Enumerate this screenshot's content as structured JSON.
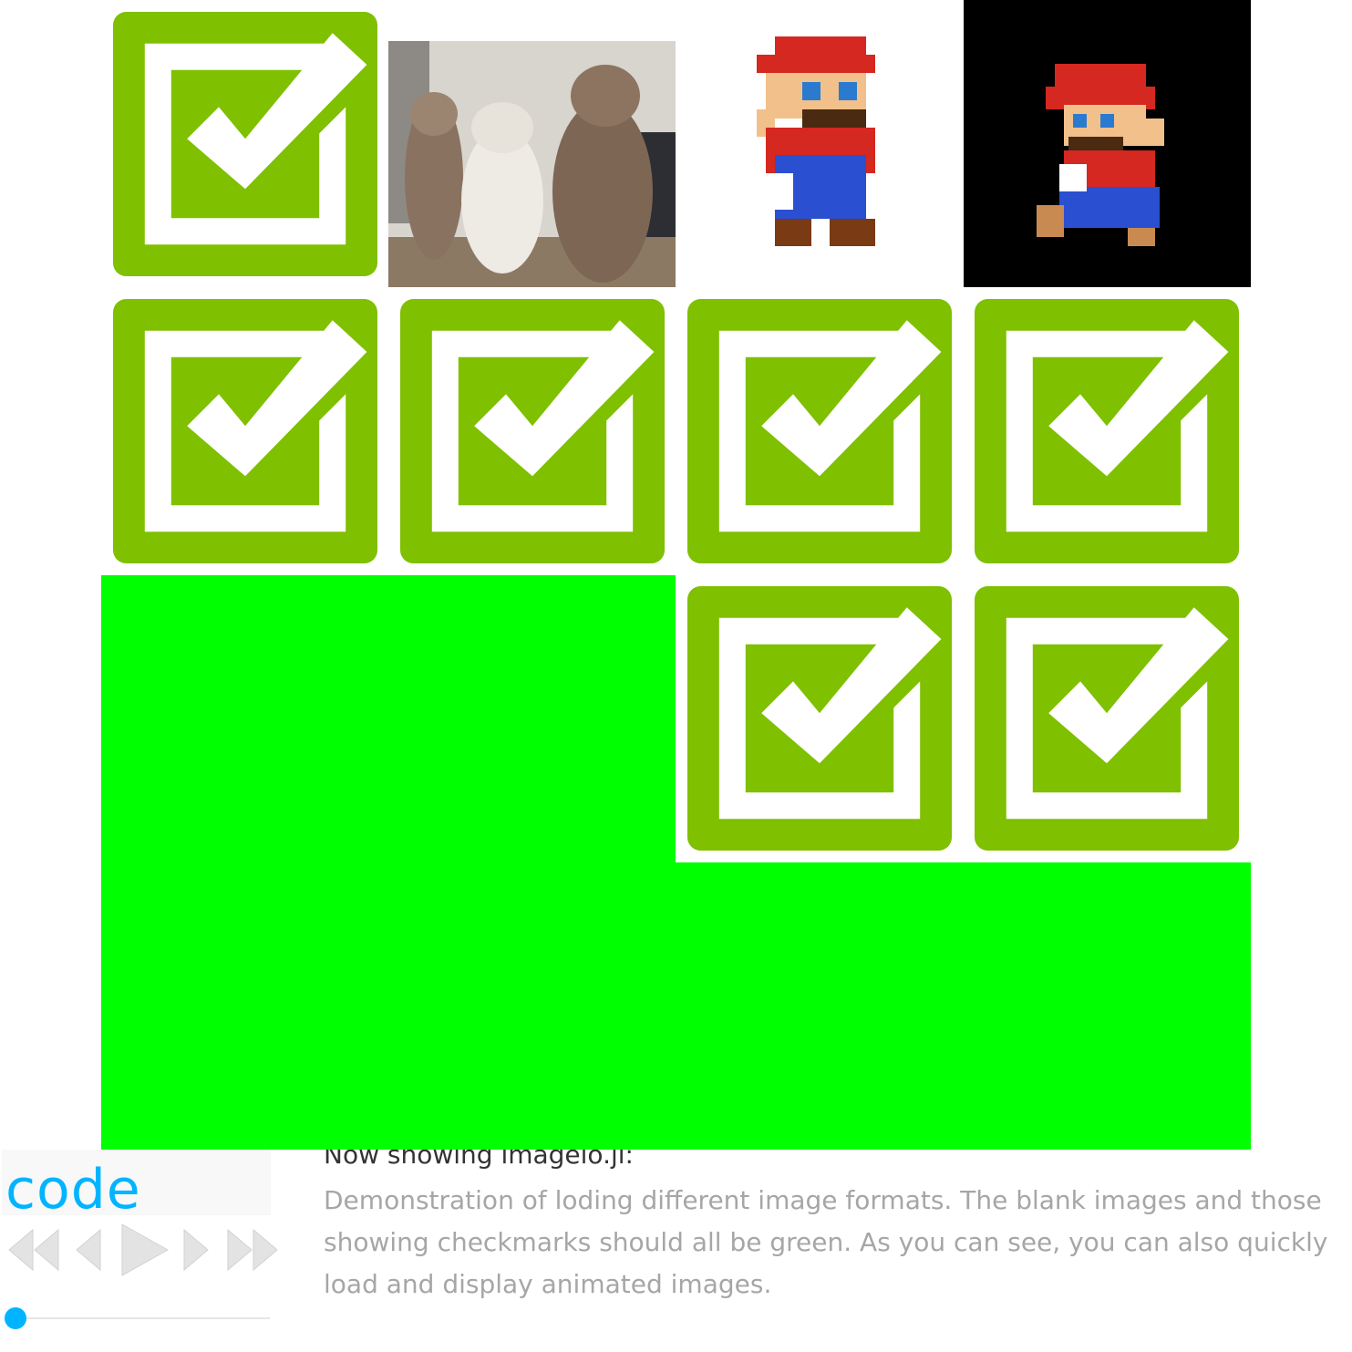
{
  "title": "Now showing imageio.jl:",
  "description": "Demonstration of loding different image formats. The blank images and those showing checkmarks should all be green. As you can see, you can also quickly load and display animated images.",
  "controls": {
    "label": "code",
    "buttons": [
      "first",
      "previous",
      "play",
      "next",
      "last"
    ],
    "slider_value": 0
  },
  "images": [
    {
      "kind": "checkmark",
      "icon": "checkmark-icon"
    },
    {
      "kind": "photo",
      "icon": "cats-photo"
    },
    {
      "kind": "sprite",
      "icon": "mario-standing-sprite"
    },
    {
      "kind": "sprite",
      "icon": "mario-running-sprite"
    },
    {
      "kind": "checkmark",
      "icon": "checkmark-icon"
    },
    {
      "kind": "checkmark",
      "icon": "checkmark-icon"
    },
    {
      "kind": "checkmark",
      "icon": "checkmark-icon"
    },
    {
      "kind": "checkmark",
      "icon": "checkmark-icon"
    },
    {
      "kind": "solid",
      "color": "#00ff00"
    },
    {
      "kind": "checkmark",
      "icon": "checkmark-icon"
    },
    {
      "kind": "checkmark",
      "icon": "checkmark-icon"
    },
    {
      "kind": "solid",
      "color": "#00ff00"
    }
  ],
  "colors": {
    "check_green": "#7fc000",
    "solid_green": "#00ff00",
    "accent": "#00b4ff",
    "button_gray": "#e3e3e3"
  }
}
